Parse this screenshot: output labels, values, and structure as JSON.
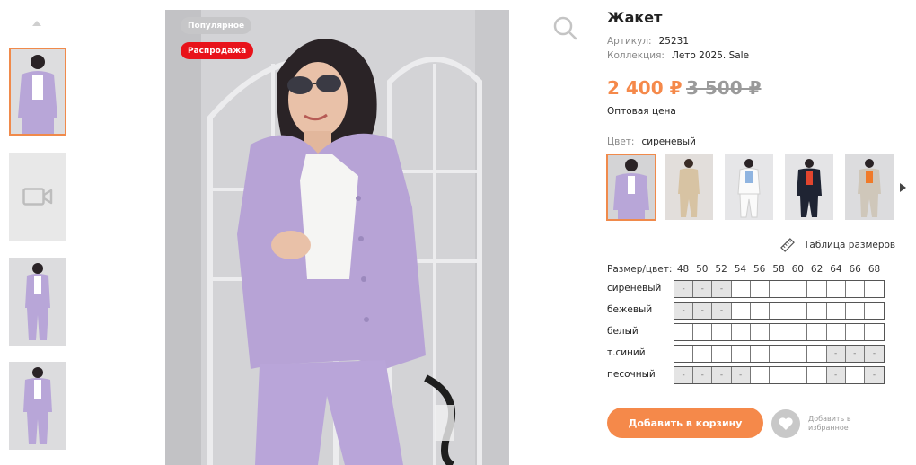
{
  "gallery": {
    "thumbnails": [
      {
        "kind": "photo",
        "active": true
      },
      {
        "kind": "video",
        "icon": "video-camera-icon"
      },
      {
        "kind": "photo",
        "active": false
      },
      {
        "kind": "photo",
        "active": false
      }
    ]
  },
  "main_image": {
    "badges": {
      "popular": "Популярное",
      "sale": "Распродажа"
    }
  },
  "product": {
    "title": "Жакет",
    "article_label": "Артикул:",
    "article_value": "25231",
    "collection_label": "Коллекция:",
    "collection_value": "Лето 2025. Sale",
    "price_current": "2 400 ₽",
    "price_old": "3 500 ₽",
    "price_note": "Оптовая цена",
    "color_label": "Цвет:",
    "color_value": "сиреневый",
    "color_swatches": [
      "сиреневый",
      "бежевый",
      "белый",
      "т.синий",
      "песочный"
    ]
  },
  "sizes": {
    "size_table_link": "Таблица размеров",
    "header_label": "Размер/цвет:",
    "sizes": [
      "48",
      "50",
      "52",
      "54",
      "56",
      "58",
      "60",
      "62",
      "64",
      "66",
      "68"
    ],
    "rows": [
      {
        "color": "сиреневый",
        "cells": [
          "-",
          "-",
          "-",
          "",
          "",
          "",
          "",
          "",
          "",
          "",
          ""
        ]
      },
      {
        "color": "бежевый",
        "cells": [
          "-",
          "-",
          "-",
          "",
          "",
          "",
          "",
          "",
          "",
          "",
          ""
        ]
      },
      {
        "color": "белый",
        "cells": [
          "",
          "",
          "",
          "",
          "",
          "",
          "",
          "",
          "",
          "",
          ""
        ]
      },
      {
        "color": "т.синий",
        "cells": [
          "",
          "",
          "",
          "",
          "",
          "",
          "",
          "",
          "-",
          "-",
          "-"
        ]
      },
      {
        "color": "песочный",
        "cells": [
          "-",
          "-",
          "-",
          "-",
          "",
          "",
          "",
          "",
          "-",
          "",
          "-"
        ]
      }
    ]
  },
  "actions": {
    "add_to_cart": "Добавить в корзину",
    "favorite_line1": "Добавить в",
    "favorite_line2": "избранное"
  },
  "colors": {
    "accent": "#f5894a",
    "sale_badge": "#e8121a",
    "popular_badge": "#c6c6c8",
    "thumb_border": "#f08a4b"
  }
}
